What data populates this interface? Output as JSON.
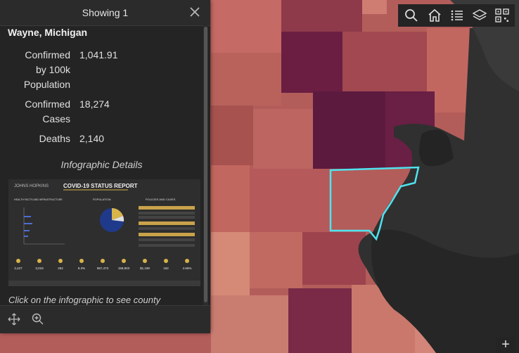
{
  "popup": {
    "header_title": "Showing 1",
    "county_name": "Wayne, Michigan",
    "fields": [
      {
        "label_lines": [
          "Confirmed",
          "by 100k",
          "Population"
        ],
        "value": "1,041.91"
      },
      {
        "label_lines": [
          "Confirmed",
          "Cases"
        ],
        "value": "18,274"
      },
      {
        "label_lines": [
          "Deaths"
        ],
        "value": "2,140"
      }
    ],
    "infographic_title": "Infographic Details",
    "infographic": {
      "report_title": "COVID-19 STATUS REPORT",
      "brand": "JOHNS HOPKINS",
      "section_health": "HEALTH FACTS AND INFRASTRUCTURE",
      "section_population": "POPULATION",
      "section_policies": "POLICIES AND CASES",
      "stats": [
        "2,427",
        "3,019",
        "252",
        "8.3%",
        "957,473",
        "158,903",
        "$1,199",
        "162",
        "4.66%"
      ]
    },
    "click_note": "Click on the infographic to see county"
  },
  "colors": {
    "highlight": "#4fe3ef",
    "darkest": "#5a1a3c",
    "panel": "#242424"
  },
  "icons": {
    "close": "close-icon",
    "move": "move-icon",
    "zoom_to": "zoom-to-icon",
    "toolbar": [
      "search-icon",
      "home-icon",
      "legend-icon",
      "layers-icon",
      "qr-icon"
    ],
    "zoom_in": "plus-icon"
  },
  "zoom_in_label": "+"
}
